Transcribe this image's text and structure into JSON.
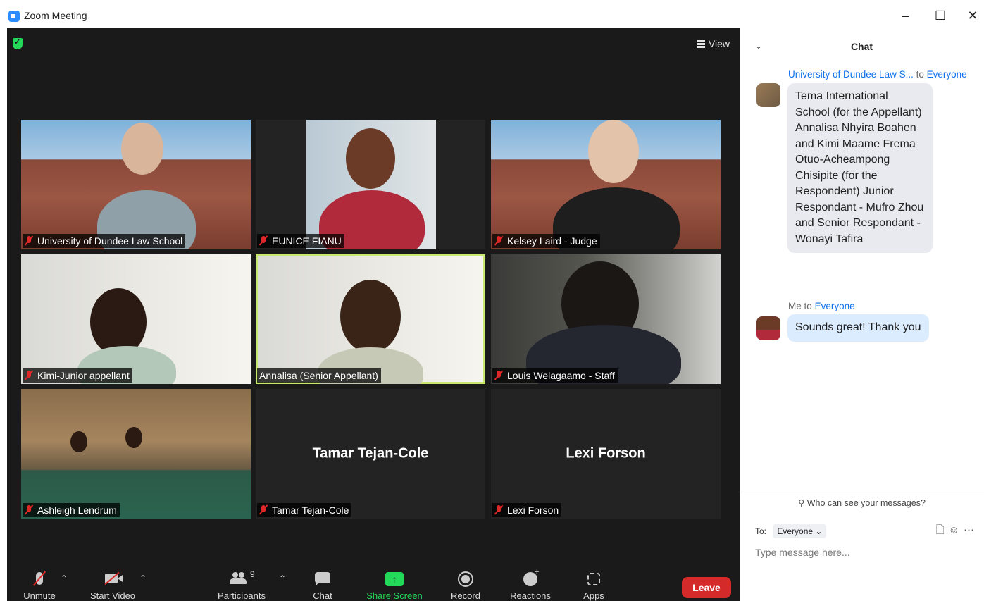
{
  "window": {
    "title": "Zoom Meeting",
    "minimize": "–",
    "maximize": "☐",
    "close": "✕"
  },
  "meeting": {
    "view_label": "View",
    "tiles": [
      {
        "label": "University of Dundee Law School",
        "muted": true
      },
      {
        "label": "EUNICE FIANU",
        "muted": true
      },
      {
        "label": "Kelsey Laird - Judge",
        "muted": true
      },
      {
        "label": "Kimi-Junior appellant",
        "muted": true
      },
      {
        "label": "Annalisa (Senior Appellant)",
        "muted": false,
        "active_speaker": true
      },
      {
        "label": "Louis Welagaamo - Staff",
        "muted": true
      },
      {
        "label": "Ashleigh Lendrum",
        "muted": true
      },
      {
        "label": "Tamar Tejan-Cole",
        "muted": true,
        "center_name": "Tamar Tejan-Cole"
      },
      {
        "label": "Lexi Forson",
        "muted": true,
        "center_name": "Lexi Forson"
      }
    ]
  },
  "toolbar": {
    "unmute": "Unmute",
    "start_video": "Start Video",
    "participants": "Participants",
    "participants_count": "9",
    "chat": "Chat",
    "share_screen": "Share Screen",
    "record": "Record",
    "reactions": "Reactions",
    "apps": "Apps",
    "leave": "Leave",
    "share_color": "#23d959",
    "leave_color": "#d42a2a"
  },
  "chat": {
    "title": "Chat",
    "messages": [
      {
        "sender": "University of Dundee Law S...",
        "to_word": "to",
        "recipient": "Everyone",
        "text": "Tema International School (for the Appellant) Annalisa Nhyira Boahen and Kimi Maame Frema Otuo-Acheampong Chisipite (for the Respondent) Junior Respondant - Mufro Zhou and Senior Respondant - Wonayi Tafira"
      },
      {
        "sender": "Me",
        "to_word": "to",
        "recipient": "Everyone",
        "text": "Sounds great! Thank you"
      }
    ],
    "who_can_see": "Who can see your messages?",
    "to_label": "To:",
    "to_value": "Everyone",
    "input_placeholder": "Type message here..."
  }
}
